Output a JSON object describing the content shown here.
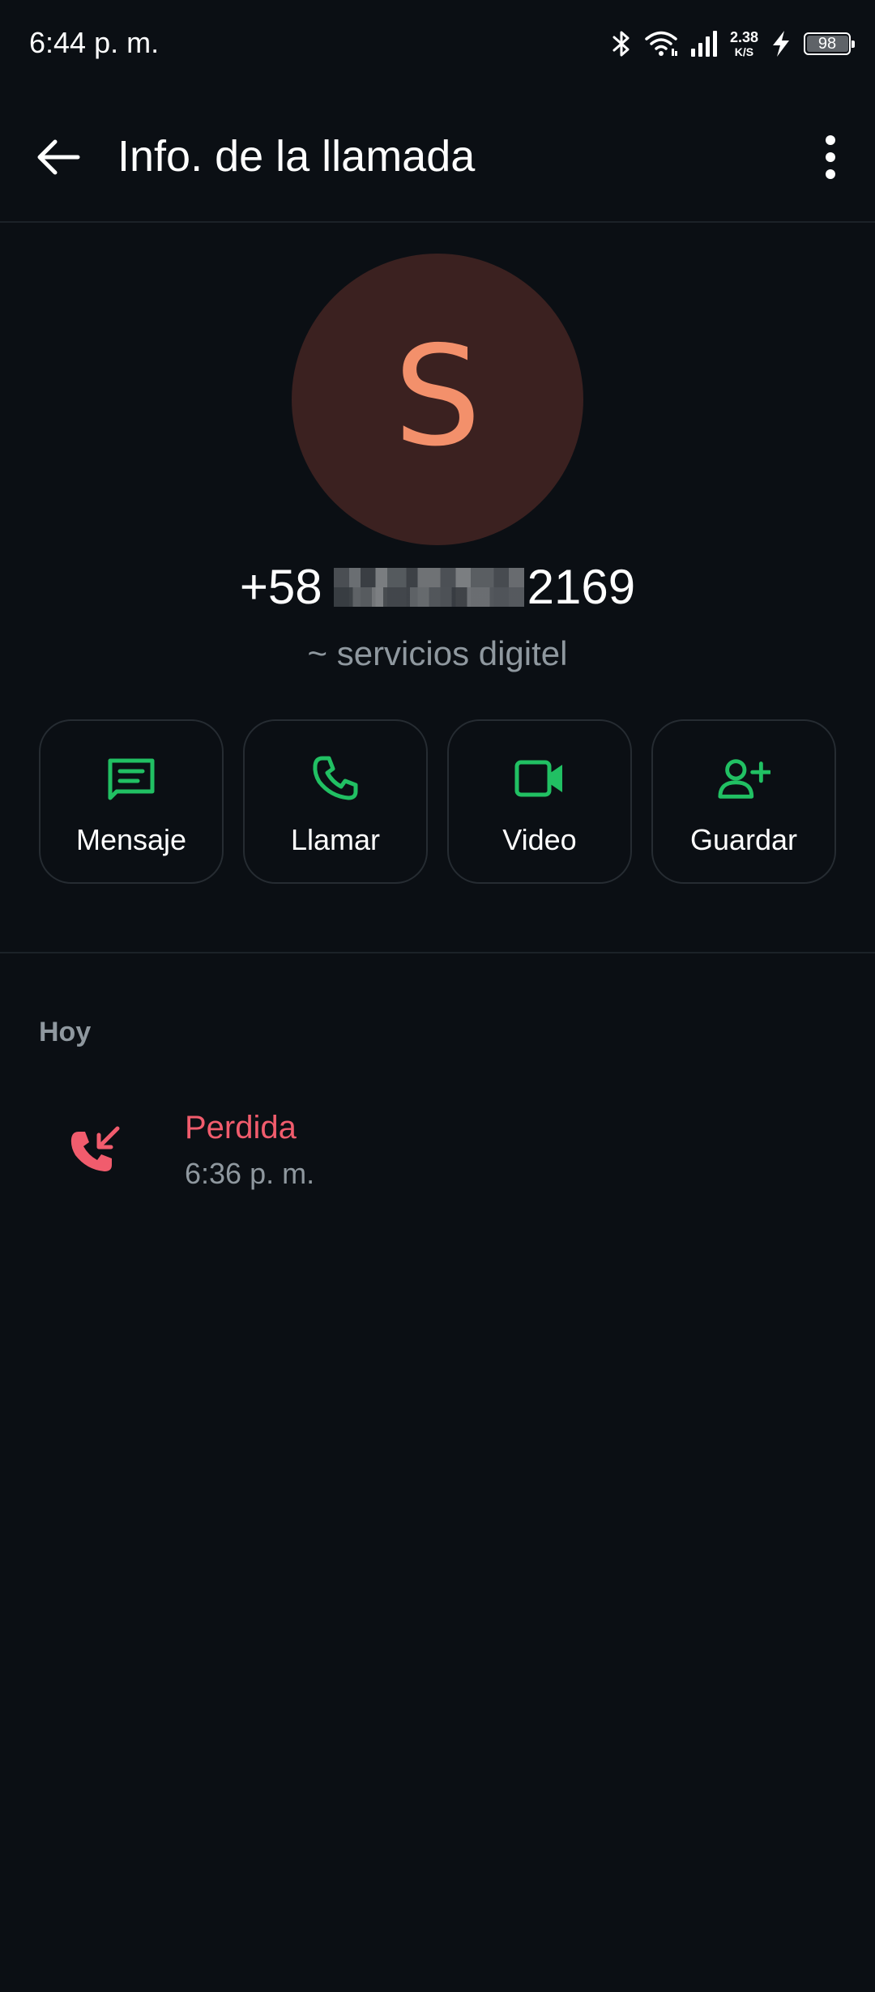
{
  "status_bar": {
    "time": "6:44 p. m.",
    "net_speed_value": "2.38",
    "net_speed_unit": "K/S",
    "battery_level": "98",
    "icons": [
      "bluetooth-icon",
      "wifi-icon",
      "signal-icon",
      "charging-icon",
      "battery-icon"
    ]
  },
  "app_bar": {
    "title": "Info. de la llamada",
    "back_icon": "arrow-left-icon",
    "menu_icon": "more-vertical-icon"
  },
  "contact": {
    "avatar_letter": "S",
    "phone_prefix": "+58",
    "phone_suffix": "2169",
    "subtitle": "~ servicios digitel"
  },
  "actions": [
    {
      "label": "Mensaje",
      "icon": "message-icon"
    },
    {
      "label": "Llamar",
      "icon": "phone-icon"
    },
    {
      "label": "Video",
      "icon": "video-icon"
    },
    {
      "label": "Guardar",
      "icon": "add-contact-icon"
    }
  ],
  "history": {
    "section_title": "Hoy",
    "calls": [
      {
        "status": "Perdida",
        "time": "6:36 p. m.",
        "icon": "missed-call-icon"
      }
    ]
  },
  "colors": {
    "background": "#0b0f14",
    "accent_green": "#21c063",
    "missed_red": "#f15c6d",
    "avatar_bg": "#3b2120",
    "avatar_letter": "#f3906b",
    "secondary_text": "#8f989f"
  }
}
